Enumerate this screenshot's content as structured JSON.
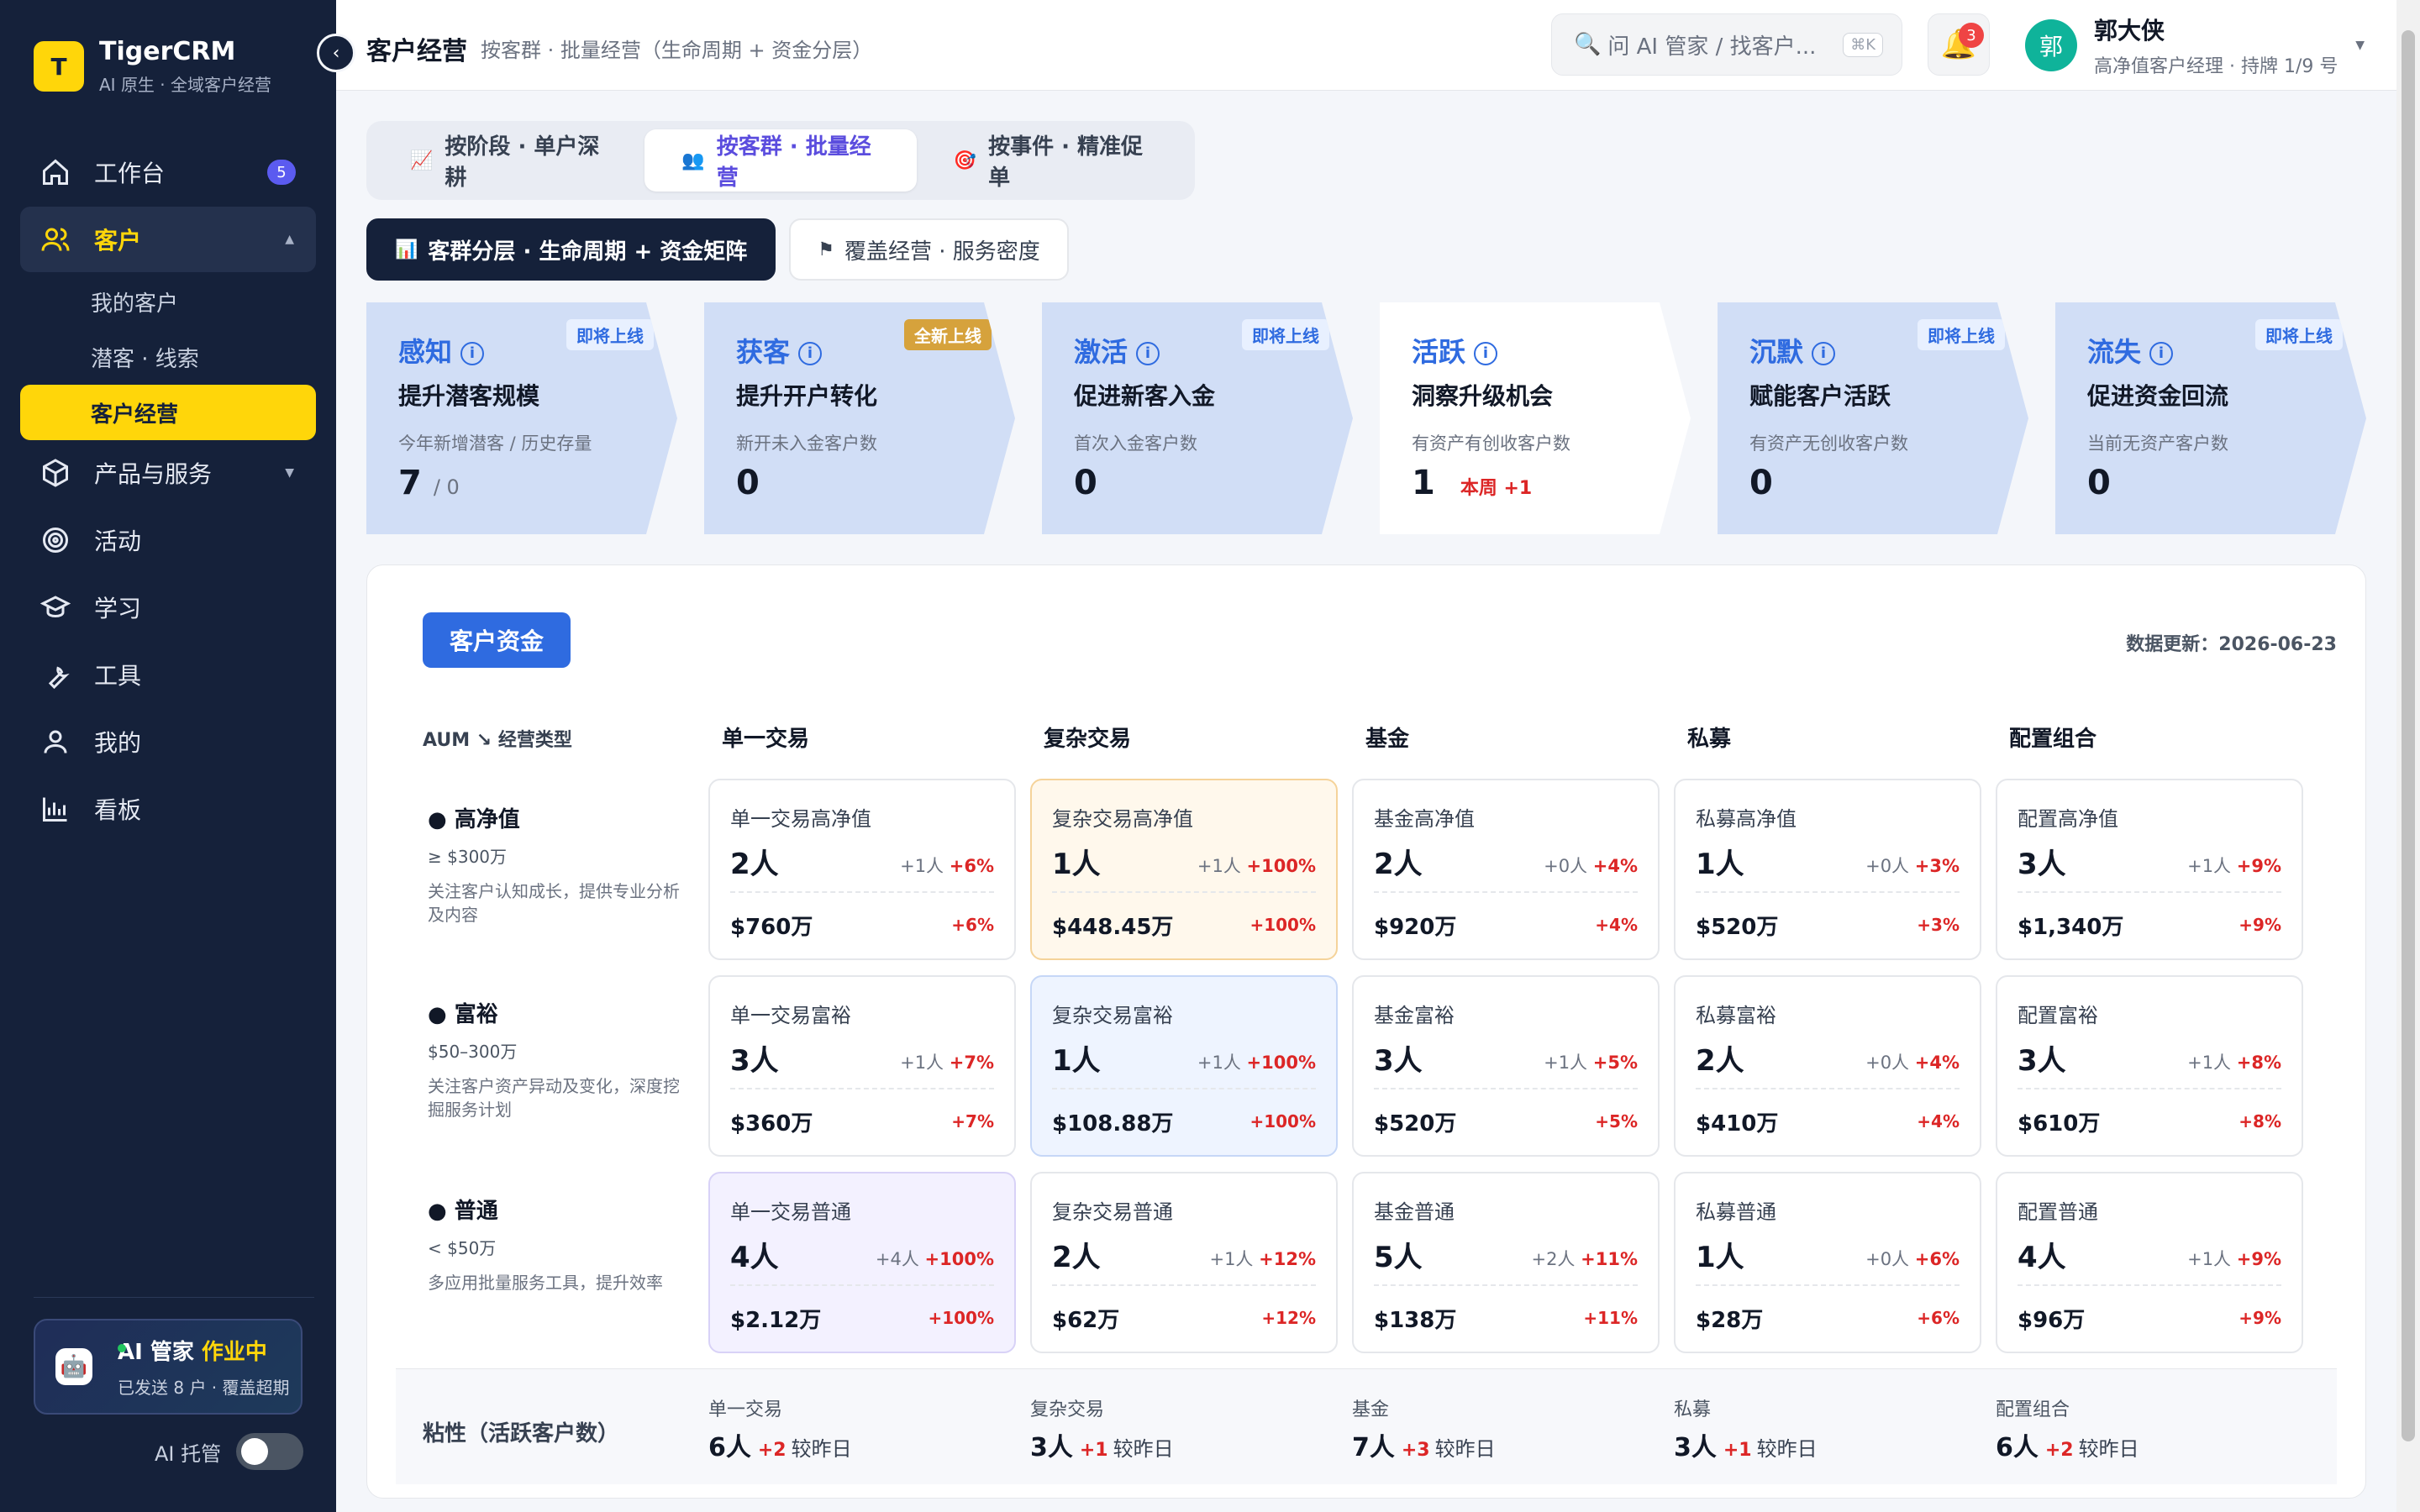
{
  "brand": {
    "logo": "T",
    "name": "TigerCRM",
    "sub": "AI 原生 · 全域客户经营"
  },
  "nav": {
    "workbench": "工作台",
    "workbench_badge": "5",
    "customer": "客户",
    "customer_subs": [
      "我的客户",
      "潜客 · 线索",
      "客户经营"
    ],
    "products": "产品与服务",
    "activity": "活动",
    "learning": "学习",
    "tools": "工具",
    "mine": "我的",
    "dashboard": "看板"
  },
  "ai": {
    "title": "AI 管家",
    "status": "作业中",
    "sub": "已发送 8 户 · 覆盖超期",
    "toggle_label": "AI 托管"
  },
  "header": {
    "title": "客户经营",
    "subtitle": "按客群 · 批量经营（生命周期 + 资金分层）",
    "search_placeholder": "问 AI 管家 / 找客户...",
    "search_kbd": "⌘K",
    "notif_count": "3",
    "user_initial": "郭",
    "user_name": "郭大侠",
    "user_role": "高净值客户经理 · 持牌 1/9 号"
  },
  "mode_tabs": [
    {
      "icon": "📈",
      "label": "按阶段 · 单户深耕"
    },
    {
      "icon": "👥",
      "label": "按客群 · 批量经营"
    },
    {
      "icon": "🎯",
      "label": "按事件 · 精准促单"
    }
  ],
  "sub_tabs": [
    {
      "icon": "📊",
      "label": "客群分层 · 生命周期 + 资金矩阵"
    },
    {
      "icon": "⚑",
      "label": "覆盖经营 · 服务密度"
    }
  ],
  "stages": [
    {
      "name": "感知",
      "tag": "即将上线",
      "goal": "提升潜客规模",
      "desc": "今年新增潜客 / 历史存量",
      "num": "7",
      "den": "/ 0",
      "week": ""
    },
    {
      "name": "获客",
      "tag": "全新上线",
      "goal": "提升开户转化",
      "desc": "新开未入金客户数",
      "num": "0",
      "den": "",
      "week": ""
    },
    {
      "name": "激活",
      "tag": "即将上线",
      "goal": "促进新客入金",
      "desc": "首次入金客户数",
      "num": "0",
      "den": "",
      "week": ""
    },
    {
      "name": "活跃",
      "tag": "",
      "goal": "洞察升级机会",
      "desc": "有资产有创收客户数",
      "num": "1",
      "den": "",
      "week": "本周 +1"
    },
    {
      "name": "沉默",
      "tag": "即将上线",
      "goal": "赋能客户活跃",
      "desc": "有资产无创收客户数",
      "num": "0",
      "den": "",
      "week": ""
    },
    {
      "name": "流失",
      "tag": "即将上线",
      "goal": "促进资金回流",
      "desc": "当前无资产客户数",
      "num": "0",
      "den": "",
      "week": ""
    }
  ],
  "panel": {
    "button": "客户资金",
    "update": "数据更新：2026-06-23",
    "axis_label": "AUM ↘ 经营类型",
    "columns": [
      "单一交易",
      "复杂交易",
      "基金",
      "私募",
      "配置组合"
    ],
    "rows": [
      {
        "title": "● 高净值",
        "range": "≥ $300万",
        "desc": "关注客户认知成长，提供专业分析及内容"
      },
      {
        "title": "● 富裕",
        "range": "$50–300万",
        "desc": "关注客户资产异动及变化，深度挖掘服务计划"
      },
      {
        "title": "● 普通",
        "range": "< $50万",
        "desc": "多应用批量服务工具，提升效率"
      }
    ],
    "cells": [
      [
        {
          "title": "单一交易高净值",
          "count": "2人",
          "delta": "+1人",
          "pct": "+6%",
          "amount": "$760万",
          "apct": "+6%"
        },
        {
          "title": "复杂交易高净值",
          "count": "1人",
          "delta": "+1人",
          "pct": "+100%",
          "amount": "$448.45万",
          "apct": "+100%"
        },
        {
          "title": "基金高净值",
          "count": "2人",
          "delta": "+0人",
          "pct": "+4%",
          "amount": "$920万",
          "apct": "+4%"
        },
        {
          "title": "私募高净值",
          "count": "1人",
          "delta": "+0人",
          "pct": "+3%",
          "amount": "$520万",
          "apct": "+3%"
        },
        {
          "title": "配置高净值",
          "count": "3人",
          "delta": "+1人",
          "pct": "+9%",
          "amount": "$1,340万",
          "apct": "+9%"
        }
      ],
      [
        {
          "title": "单一交易富裕",
          "count": "3人",
          "delta": "+1人",
          "pct": "+7%",
          "amount": "$360万",
          "apct": "+7%"
        },
        {
          "title": "复杂交易富裕",
          "count": "1人",
          "delta": "+1人",
          "pct": "+100%",
          "amount": "$108.88万",
          "apct": "+100%"
        },
        {
          "title": "基金富裕",
          "count": "3人",
          "delta": "+1人",
          "pct": "+5%",
          "amount": "$520万",
          "apct": "+5%"
        },
        {
          "title": "私募富裕",
          "count": "2人",
          "delta": "+0人",
          "pct": "+4%",
          "amount": "$410万",
          "apct": "+4%"
        },
        {
          "title": "配置富裕",
          "count": "3人",
          "delta": "+1人",
          "pct": "+8%",
          "amount": "$610万",
          "apct": "+8%"
        }
      ],
      [
        {
          "title": "单一交易普通",
          "count": "4人",
          "delta": "+4人",
          "pct": "+100%",
          "amount": "$2.12万",
          "apct": "+100%"
        },
        {
          "title": "复杂交易普通",
          "count": "2人",
          "delta": "+1人",
          "pct": "+12%",
          "amount": "$62万",
          "apct": "+12%"
        },
        {
          "title": "基金普通",
          "count": "5人",
          "delta": "+2人",
          "pct": "+11%",
          "amount": "$138万",
          "apct": "+11%"
        },
        {
          "title": "私募普通",
          "count": "1人",
          "delta": "+0人",
          "pct": "+6%",
          "amount": "$28万",
          "apct": "+6%"
        },
        {
          "title": "配置普通",
          "count": "4人",
          "delta": "+1人",
          "pct": "+9%",
          "amount": "$96万",
          "apct": "+9%"
        }
      ]
    ],
    "stickiness": {
      "label": "粘性（活跃客户数）",
      "items": [
        {
          "name": "单一交易",
          "val": "6人",
          "up": "+2",
          "cmp": "较昨日"
        },
        {
          "name": "复杂交易",
          "val": "3人",
          "up": "+1",
          "cmp": "较昨日"
        },
        {
          "name": "基金",
          "val": "7人",
          "up": "+3",
          "cmp": "较昨日"
        },
        {
          "name": "私募",
          "val": "3人",
          "up": "+1",
          "cmp": "较昨日"
        },
        {
          "name": "配置组合",
          "val": "6人",
          "up": "+2",
          "cmp": "较昨日"
        }
      ]
    }
  }
}
